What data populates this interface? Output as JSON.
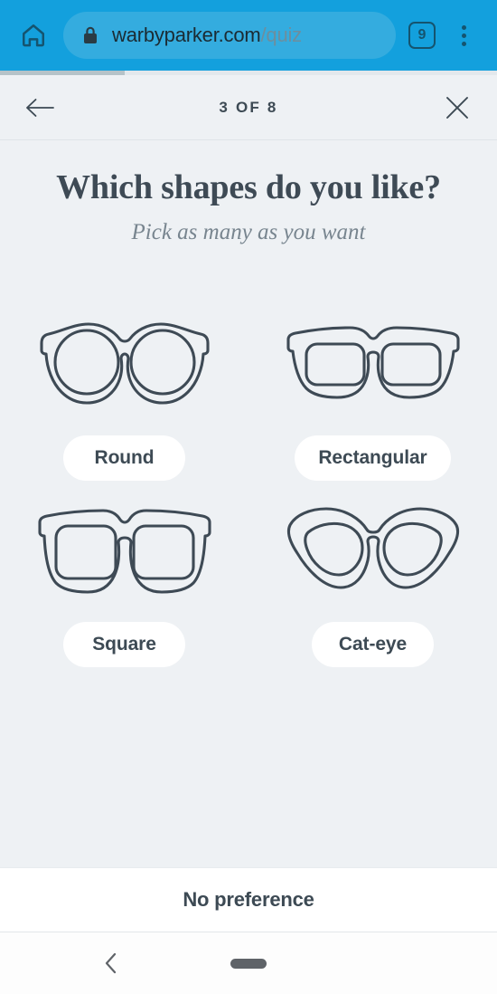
{
  "browser": {
    "home_icon": "home-icon",
    "lock_icon": "lock-icon",
    "url_domain": "warbyparker.com",
    "url_path": "/quiz",
    "tab_count": "9",
    "menu_icon": "overflow-menu-icon",
    "toolbar_color": "#13a0dd",
    "omnibox_color": "#34acdf"
  },
  "quiz_header": {
    "back_icon": "back-arrow-icon",
    "close_icon": "close-icon",
    "step_label": "3 OF 8",
    "progress_percent": 25
  },
  "main": {
    "title": "Which shapes do you like?",
    "subtitle": "Pick as many as you want",
    "background_color": "#eef1f4",
    "options": [
      {
        "label": "Round",
        "icon": "round-glasses-icon",
        "selected": false
      },
      {
        "label": "Rectangular",
        "icon": "rectangular-glasses-icon",
        "selected": false
      },
      {
        "label": "Square",
        "icon": "square-glasses-icon",
        "selected": false
      },
      {
        "label": "Cat-eye",
        "icon": "cat-eye-glasses-icon",
        "selected": false
      }
    ]
  },
  "footer": {
    "no_preference_label": "No preference"
  },
  "android_nav": {
    "back_icon": "chevron-left-icon",
    "home_handle": "gesture-home-handle"
  }
}
